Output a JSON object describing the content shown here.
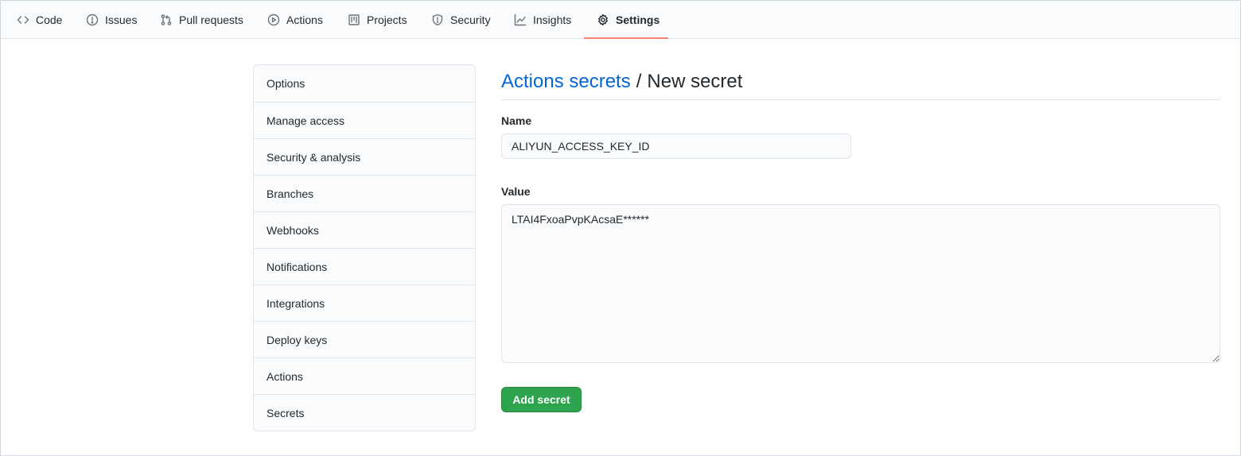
{
  "nav": {
    "tabs": [
      {
        "label": "Code",
        "icon": "code-icon"
      },
      {
        "label": "Issues",
        "icon": "issue-icon"
      },
      {
        "label": "Pull requests",
        "icon": "pull-request-icon"
      },
      {
        "label": "Actions",
        "icon": "play-icon"
      },
      {
        "label": "Projects",
        "icon": "project-icon"
      },
      {
        "label": "Security",
        "icon": "shield-icon"
      },
      {
        "label": "Insights",
        "icon": "graph-icon"
      },
      {
        "label": "Settings",
        "icon": "gear-icon",
        "selected": true
      }
    ],
    "accent_color": "#f9826c"
  },
  "sidebar": {
    "items": [
      {
        "label": "Options"
      },
      {
        "label": "Manage access"
      },
      {
        "label": "Security & analysis"
      },
      {
        "label": "Branches"
      },
      {
        "label": "Webhooks"
      },
      {
        "label": "Notifications"
      },
      {
        "label": "Integrations"
      },
      {
        "label": "Deploy keys"
      },
      {
        "label": "Actions"
      },
      {
        "label": "Secrets"
      }
    ]
  },
  "main": {
    "breadcrumb_link": "Actions secrets",
    "breadcrumb_separator": "/",
    "title": "New secret",
    "name_label": "Name",
    "name_value": "ALIYUN_ACCESS_KEY_ID",
    "value_label": "Value",
    "value_text": "LTAI4FxoaPvpKAcsaE******",
    "submit_label": "Add secret",
    "link_color": "#0366d6",
    "button_color": "#2ea44f"
  }
}
